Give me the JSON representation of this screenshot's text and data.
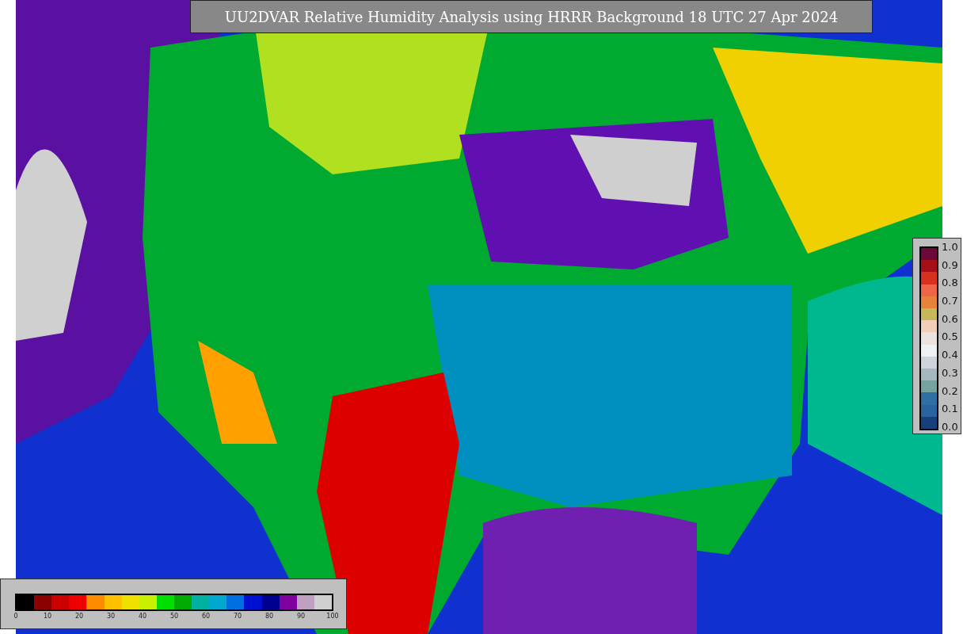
{
  "title": "UU2DVAR Relative Humidity Analysis using HRRR Background 18 UTC 27 Apr 2024",
  "humidity_colorbar": {
    "ticks": [
      "0",
      "10",
      "20",
      "30",
      "40",
      "50",
      "60",
      "70",
      "80",
      "90",
      "100"
    ]
  },
  "weight_colorbar": {
    "ticks": [
      "1.0",
      "0.9",
      "0.8",
      "0.7",
      "0.6",
      "0.5",
      "0.4",
      "0.3",
      "0.2",
      "0.1",
      "0.0"
    ]
  }
}
